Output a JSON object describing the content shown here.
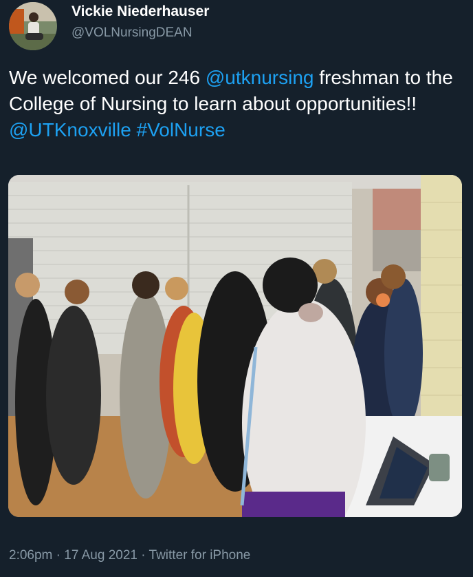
{
  "author": {
    "display_name": "Vickie Niederhauser",
    "handle": "@VOLNursingDEAN"
  },
  "tweet": {
    "text_1": "We welcomed our 246 ",
    "mention_1": "@utknursing",
    "text_2": "  freshman to the College of Nursing to learn about opportunities!! ",
    "mention_2": "@UTKnoxville",
    "text_3": " ",
    "hashtag_1": "#VolNurse"
  },
  "meta": {
    "time": "2:06pm",
    "sep_1": " · ",
    "date": "17 Aug 2021",
    "sep_2": " · ",
    "source": "Twitter for iPhone"
  },
  "colors": {
    "background": "#15202b",
    "link": "#1da1f2",
    "secondary_text": "#8899a6"
  }
}
